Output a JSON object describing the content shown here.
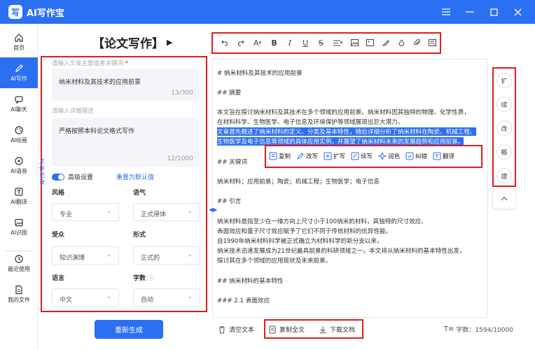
{
  "app": {
    "logo_letter": "写",
    "title": "AI写作宝",
    "window_buttons": [
      "menu-icon",
      "minimize-icon",
      "maximize-icon",
      "close-icon"
    ]
  },
  "nav": {
    "items": [
      {
        "label": "首页",
        "icon": "home-icon"
      },
      {
        "label": "AI写作",
        "icon": "pen-icon",
        "active": true
      },
      {
        "label": "AI聊天",
        "icon": "chat-icon"
      },
      {
        "label": "AI绘画",
        "icon": "palette-icon"
      },
      {
        "label": "AI语音",
        "icon": "mic-icon"
      },
      {
        "label": "AI翻译",
        "icon": "translate-icon"
      },
      {
        "label": "AI识图",
        "icon": "image-icon"
      },
      {
        "label": "最近使用",
        "icon": "history-icon"
      },
      {
        "label": "我的文件",
        "icon": "file-icon"
      }
    ]
  },
  "settings": {
    "panel_title": "【论文写作】",
    "topic_label": "请输入文章主题或者关键词",
    "topic_required": "*",
    "topic_value": "纳米材料及其技术的应用前景",
    "topic_count": "13/300",
    "detail_label": "请输入详细描述",
    "detail_value": "严格按照本科论文格式写作",
    "detail_count": "12/1000",
    "advanced_label": "高级设置",
    "reset_label": "重置为默认值",
    "side_tab": "文件记录",
    "style_label": "风格",
    "style_value": "专业",
    "tone_label": "语气",
    "tone_value": "正式得体",
    "audience_label": "受众",
    "audience_value": "知识渊博",
    "form_label": "形式",
    "form_value": "正式的",
    "language_label": "语言",
    "language_value": "中文",
    "words_label": "字数",
    "words_value": "自动",
    "regenerate_label": "重新生成"
  },
  "toolbar": {
    "font_letter": "A",
    "bold": "B",
    "italic": "I",
    "underline": "U",
    "strike": "S"
  },
  "editor": {
    "lines": [
      "# 纳米材料及其技术的应用前景",
      "## 摘要",
      "本文旨在探讨纳米材料及其技术在多个领域的应用前景。纳米材料因其独特的物理、化学性质，",
      "在材料科学、生物医学、电子信息及环境保护等领域展现出巨大潜力。",
      "文章首先概述了纳米材料的定义、分类及基本特性，随后详细分析了纳米材料在陶瓷、机械工程、",
      "生物医学及电子信息等领域的具体应用实例，并展望了纳米材料未来的发展趋势和应用前景。",
      "## 关键词",
      "纳米材料；应用前景；陶瓷；机械工程；生物医学；电子信息",
      "## 引言",
      "纳米材料是指至少在一维方向上尺寸小于100纳米的材料，其独特的尺寸效应、",
      "表面效应和量子尺寸效应赋予了它们不同于传统材料的优异性能。",
      "自1990年纳米材料科学被正式确立为材料科学的新分支以来，",
      "纳米技术迅速发展成为21世纪最具前景的科研领域之一。本文将从纳米材料的基本特性出发，",
      "探讨其在多个领域的应用现状及未来前景。",
      "## 纳米材料的基本特性",
      "### 2.1 表面效应"
    ],
    "float_actions": [
      {
        "label": "复制",
        "icon": "copy-icon"
      },
      {
        "label": "改写",
        "icon": "rewrite-icon"
      },
      {
        "label": "扩写",
        "icon": "expand-icon"
      },
      {
        "label": "续写",
        "icon": "continue-icon"
      },
      {
        "label": "润色",
        "icon": "polish-icon"
      },
      {
        "label": "纠错",
        "icon": "correct-icon"
      },
      {
        "label": "翻译",
        "icon": "translate-icon"
      }
    ]
  },
  "side_actions": [
    "扩",
    "续",
    "改",
    "概",
    "建"
  ],
  "footer": {
    "clear_label": "清空文本",
    "copy_all_label": "复制全文",
    "download_label": "下载文档",
    "word_count": "字数：1594/10000"
  },
  "colors": {
    "accent": "#2b6ff2",
    "highlight_box": "#e11d1d"
  }
}
